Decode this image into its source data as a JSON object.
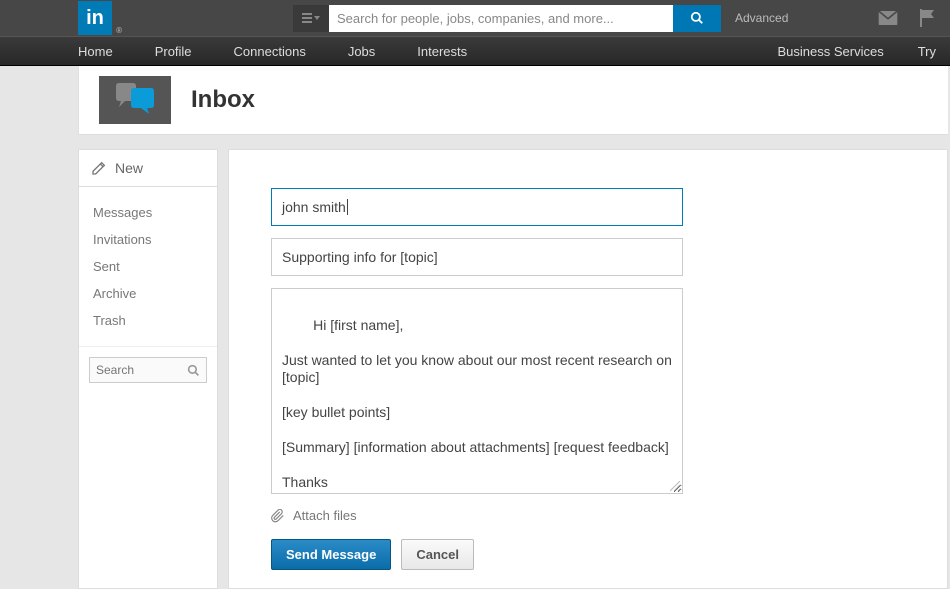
{
  "header": {
    "logo_text": "in",
    "search_placeholder": "Search for people, jobs, companies, and more...",
    "advanced_label": "Advanced"
  },
  "nav": {
    "left": [
      "Home",
      "Profile",
      "Connections",
      "Jobs",
      "Interests"
    ],
    "right": [
      "Business Services",
      "Try"
    ]
  },
  "inbox": {
    "title": "Inbox"
  },
  "sidebar": {
    "new_label": "New",
    "items": [
      "Messages",
      "Invitations",
      "Sent",
      "Archive",
      "Trash"
    ],
    "search_placeholder": "Search"
  },
  "compose": {
    "recipient": "john smith",
    "subject": "Supporting info for [topic]",
    "body": "Hi [first name],\n\nJust wanted to let you know about our most recent research on [topic]\n\n[key bullet points]\n\n[Summary] [information about attachments] [request feedback]\n\nThanks\nName",
    "attach_label": "Attach files",
    "send_label": "Send Message",
    "cancel_label": "Cancel"
  }
}
